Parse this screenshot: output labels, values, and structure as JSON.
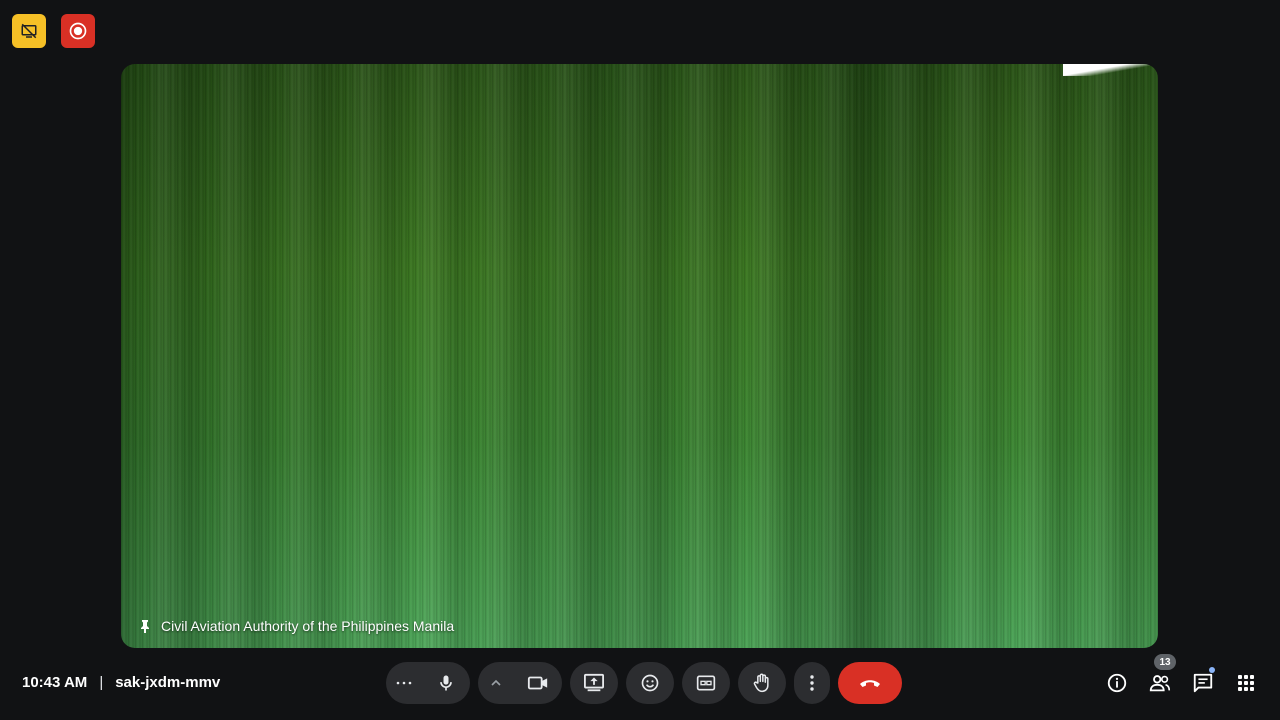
{
  "status_badges": [
    {
      "name": "presentation-off-badge",
      "icon": "no-presentation-icon",
      "color": "#f6c026"
    },
    {
      "name": "recording-badge",
      "icon": "record-icon",
      "color": "#d93025"
    }
  ],
  "tile": {
    "participant_name": "Civil Aviation Authority of the Philippines Manila",
    "pin_icon": "pin-icon"
  },
  "meeting": {
    "time": "10:43 AM",
    "separator": "|",
    "code": "sak-jxdm-mmv"
  },
  "controls": {
    "items": [
      {
        "name": "more-audio-options",
        "icon": "ellipsis-icon"
      },
      {
        "name": "microphone",
        "icon": "mic-icon"
      },
      {
        "name": "camera-options",
        "icon": "chevron-up-icon"
      },
      {
        "name": "camera",
        "icon": "video-camera-icon"
      },
      {
        "name": "present-screen",
        "icon": "present-icon"
      },
      {
        "name": "reactions",
        "icon": "emoji-icon"
      },
      {
        "name": "captions",
        "icon": "cc-icon"
      },
      {
        "name": "raise-hand",
        "icon": "hand-icon"
      },
      {
        "name": "more-options",
        "icon": "vertical-dots-icon"
      },
      {
        "name": "leave-call",
        "icon": "hang-up-icon",
        "color": "#d93025"
      }
    ]
  },
  "right_panel": {
    "participant_count": "13",
    "items": [
      {
        "name": "meeting-details",
        "icon": "info-icon"
      },
      {
        "name": "people",
        "icon": "people-icon"
      },
      {
        "name": "chat",
        "icon": "chat-icon"
      },
      {
        "name": "activities",
        "icon": "grid-icon"
      }
    ]
  }
}
